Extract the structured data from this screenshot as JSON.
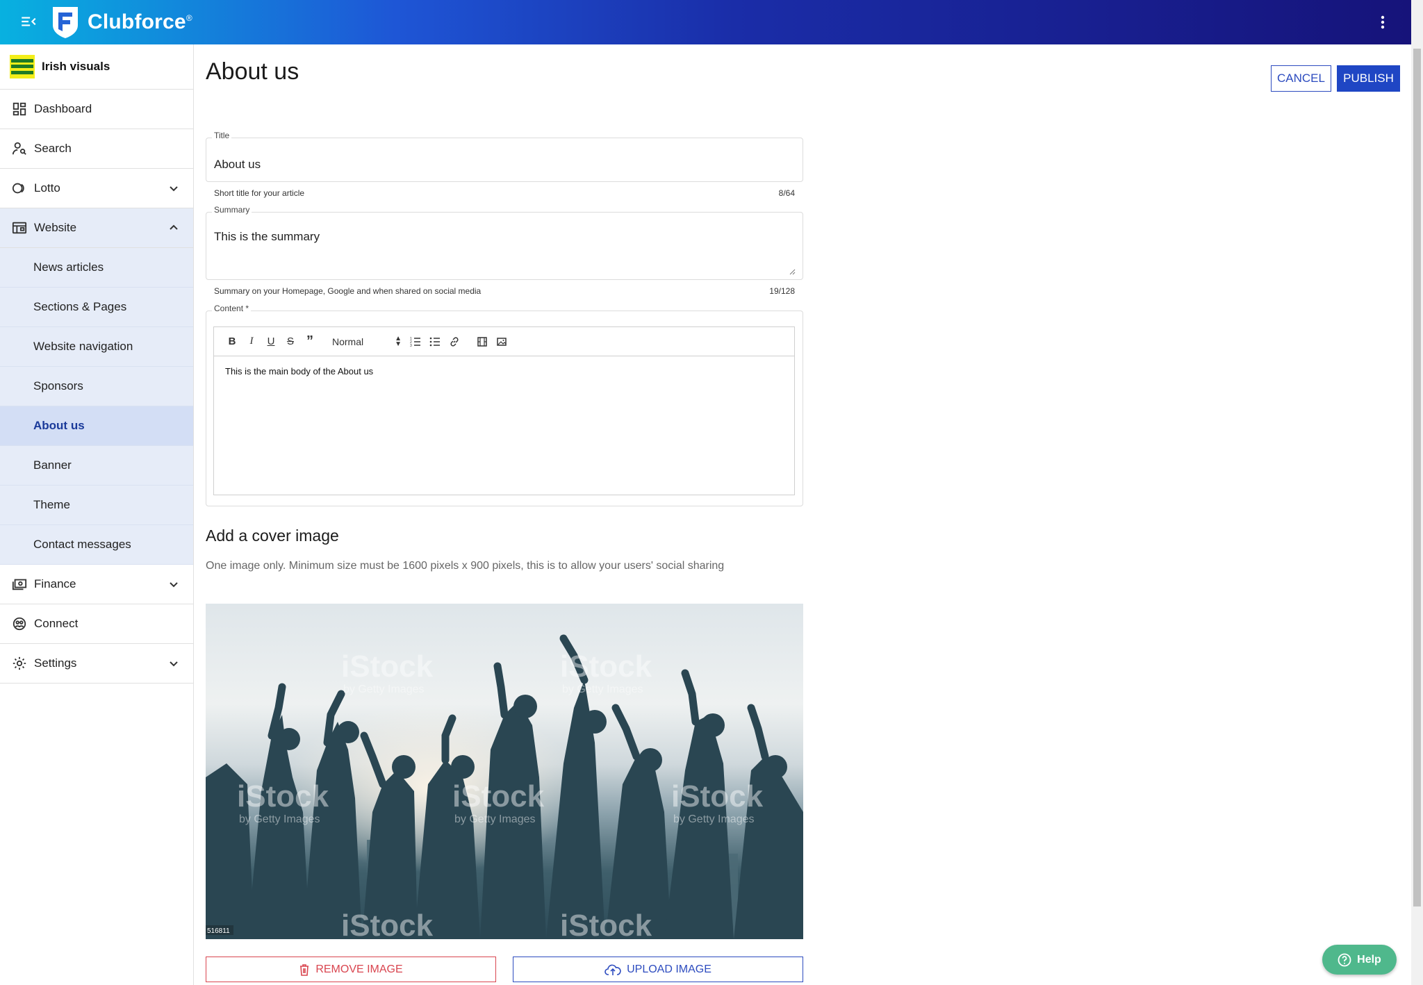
{
  "app": {
    "brand": "Clubforce",
    "brand_mark": "®"
  },
  "club": {
    "name": "Irish visuals"
  },
  "sidebar": {
    "items": [
      {
        "label": "Dashboard",
        "icon": "dashboard-icon"
      },
      {
        "label": "Search",
        "icon": "person-search-icon"
      },
      {
        "label": "Lotto",
        "icon": "lotto-icon",
        "expandable": true
      },
      {
        "label": "Website",
        "icon": "website-icon",
        "expandable": true,
        "expanded": true
      },
      {
        "label": "Finance",
        "icon": "finance-icon",
        "expandable": true
      },
      {
        "label": "Connect",
        "icon": "connect-icon"
      },
      {
        "label": "Settings",
        "icon": "gear-icon",
        "expandable": true
      }
    ],
    "website_sub": [
      {
        "label": "News articles"
      },
      {
        "label": "Sections & Pages"
      },
      {
        "label": "Website navigation"
      },
      {
        "label": "Sponsors"
      },
      {
        "label": "About us",
        "active": true
      },
      {
        "label": "Banner"
      },
      {
        "label": "Theme"
      },
      {
        "label": "Contact messages"
      }
    ]
  },
  "page": {
    "title": "About us",
    "cancel_label": "CANCEL",
    "publish_label": "PUBLISH"
  },
  "form": {
    "title": {
      "label": "Title",
      "value": "About us",
      "helper": "Short title for your article",
      "counter": "8/64"
    },
    "summary": {
      "label": "Summary",
      "value": "This is the summary",
      "helper": "Summary on your Homepage, Google and when shared on social media",
      "counter": "19/128"
    },
    "content": {
      "label": "Content *",
      "format": "Normal",
      "body": "This is the main body of the About us"
    }
  },
  "cover": {
    "title": "Add a cover image",
    "description": "One image only. Minimum size must be 1600 pixels x 900 pixels, this is to allow your users' social sharing",
    "watermark": "iStock",
    "watermark_sub": "by Getty Images",
    "image_id": "516811",
    "remove_label": "REMOVE IMAGE",
    "upload_label": "UPLOAD IMAGE"
  },
  "help": {
    "label": "Help"
  },
  "colors": {
    "primary": "#1f46c4",
    "danger": "#d9454f",
    "help": "#4fb88c",
    "active_nav": "#d3def5"
  }
}
